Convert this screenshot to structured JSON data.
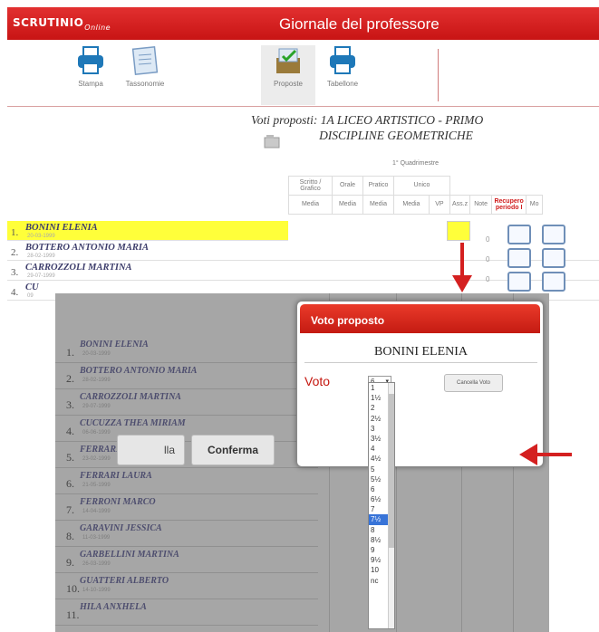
{
  "app": {
    "logo": "SCRUTINIO",
    "logo_sub": "Online",
    "title": "Giornale del professore"
  },
  "toolbar": {
    "items": [
      {
        "label": "Stampa",
        "icon": "printer-icon"
      },
      {
        "label": "Tassonomie",
        "icon": "document-icon"
      },
      {
        "label": "Proposte",
        "icon": "proposals-icon"
      },
      {
        "label": "Tabellone",
        "icon": "printer-icon"
      }
    ]
  },
  "header": {
    "line1": "Voti proposti: 1A LICEO ARTISTICO - PRIMO",
    "line2": "DISCIPLINE GEOMETRICHE"
  },
  "grid": {
    "period": "1° Quadrimestre",
    "groups": [
      "Scritto / Grafico",
      "Orale",
      "Pratico",
      "Unico"
    ],
    "subheaders": [
      "Media",
      "Media",
      "Media",
      "Media",
      "VP",
      "Ass.z",
      "Note",
      "Recupero periodo I",
      "Mo"
    ]
  },
  "students_top": [
    {
      "num": "1.",
      "name": "BONINI ELENIA",
      "date": "20-03-1999",
      "ass": "0"
    },
    {
      "num": "2.",
      "name": "BOTTERO ANTONIO MARIA",
      "date": "28-02-1999",
      "ass": "0"
    },
    {
      "num": "3.",
      "name": "CARROZZOLI MARTINA",
      "date": "29-07-1999",
      "ass": "0"
    },
    {
      "num": "4.",
      "name": "CU",
      "date": "09",
      "ass": "0"
    }
  ],
  "students_overlay": [
    {
      "num": "1.",
      "name": "BONINI ELENIA",
      "date": "20-03-1999"
    },
    {
      "num": "2.",
      "name": "BOTTERO ANTONIO MARIA",
      "date": "28-02-1999"
    },
    {
      "num": "3.",
      "name": "CARROZZOLI MARTINA",
      "date": "29-07-1999"
    },
    {
      "num": "4.",
      "name": "CUCUZZA THEA MIRIAM",
      "date": "06-06-1999"
    },
    {
      "num": "5.",
      "name": "FERRARESI ALESSIA",
      "date": "23-02-1999"
    },
    {
      "num": "6.",
      "name": "FERRARI LAURA",
      "date": "21-05-1999"
    },
    {
      "num": "7.",
      "name": "FERRONI MARCO",
      "date": "14-04-1999"
    },
    {
      "num": "8.",
      "name": "GARAVINI JESSICA",
      "date": "11-03-1999"
    },
    {
      "num": "9.",
      "name": "GARBELLINI MARTINA",
      "date": "26-03-1999"
    },
    {
      "num": "10.",
      "name": "GUATTERI ALBERTO",
      "date": "14-10-1999"
    },
    {
      "num": "11.",
      "name": "HILA ANXHELA",
      "date": ""
    }
  ],
  "dialog": {
    "title": "Voto proposto",
    "student": "BONINI ELENIA",
    "voto_label": "Voto",
    "voto_value": "6",
    "cancella_voto": "Cancella Voto",
    "annulla": "lla",
    "conferma": "Conferma"
  },
  "dropdown": {
    "options": [
      "1",
      "1½",
      "2",
      "2½",
      "3",
      "3½",
      "4",
      "4½",
      "5",
      "5½",
      "6",
      "6½",
      "7",
      "7½",
      "8",
      "8½",
      "9",
      "9½",
      "10",
      "nc"
    ],
    "highlighted": "7½"
  },
  "colors": {
    "brand_red": "#d01c1c",
    "selected_row": "#ffff3a",
    "arrow_red": "#d42020"
  }
}
